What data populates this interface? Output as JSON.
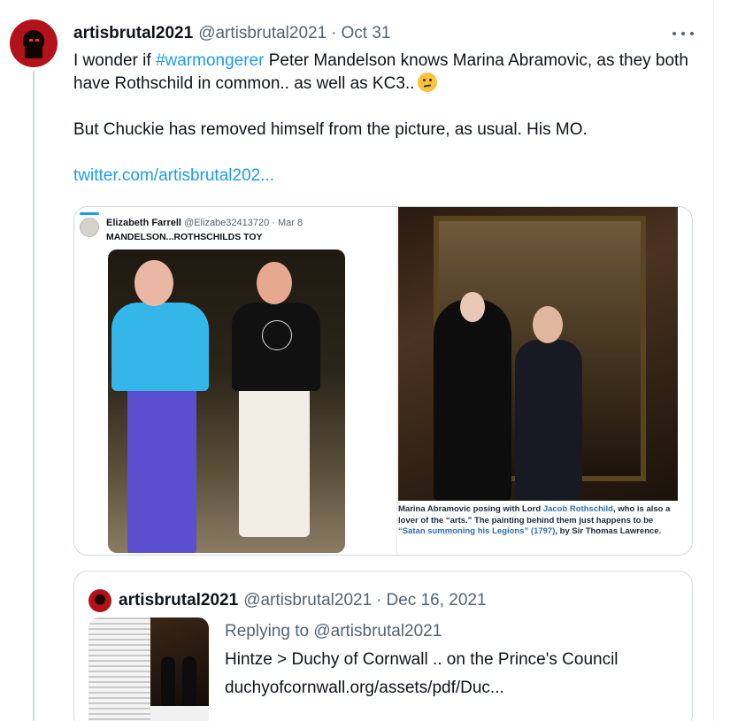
{
  "tweet": {
    "display_name": "artisbrutal2021",
    "handle": "@artisbrutal2021",
    "separator": "·",
    "date": "Oct 31",
    "text": {
      "line1_pre": "I wonder if ",
      "hashtag": "#warmongerer",
      "line1_post": " Peter Mandelson knows Marina Abramovic, as they both have Rothschild in common.. as well as KC3..",
      "emoji": "thinking-face",
      "line2": "But Chuckie has removed himself from the picture, as usual.  His MO.",
      "link": "twitter.com/artisbrutal202..."
    }
  },
  "media": {
    "left": {
      "author_name": "Elizabeth Farrell",
      "author_handle": "@Elizabe32413720 · Mar 8",
      "title": "MANDELSON...ROTHSCHILDS TOY"
    },
    "right": {
      "caption_pre": "Marina Abramovic posing with Lord ",
      "caption_link": "Jacob Rothschild",
      "caption_mid": ", who is also a lover of the “arts.” The painting behind them just happens to be ",
      "caption_title": "“Satan summoning his Legions” (1797)",
      "caption_post": ", by Sir Thomas Lawrence."
    }
  },
  "quote": {
    "display_name": "artisbrutal2021",
    "handle": "@artisbrutal2021",
    "separator": "·",
    "date": "Dec 16, 2021",
    "replying_to": "Replying to @artisbrutal2021",
    "line1": "Hintze > Duchy of Cornwall .. on the Prince's Council",
    "line2": "duchyofcornwall.org/assets/pdf/Duc..."
  },
  "colors": {
    "accent": "#1d9bf0",
    "muted": "#536471",
    "border": "#cfd9de",
    "text": "#0f1419"
  }
}
